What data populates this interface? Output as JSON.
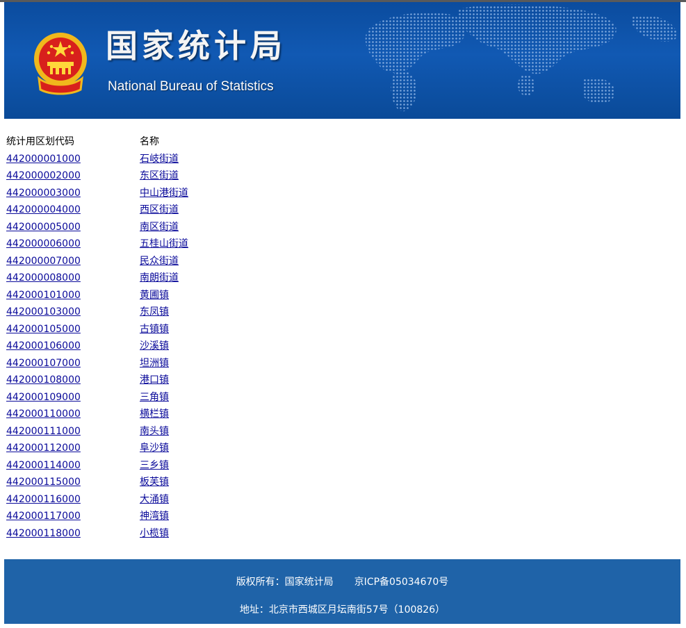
{
  "header": {
    "title_cn": "国家统计局",
    "title_en": "National Bureau of Statistics"
  },
  "table": {
    "col_code": "统计用区划代码",
    "col_name": "名称",
    "rows": [
      {
        "code": "442000001000",
        "name": "石岐街道"
      },
      {
        "code": "442000002000",
        "name": "东区街道"
      },
      {
        "code": "442000003000",
        "name": "中山港街道"
      },
      {
        "code": "442000004000",
        "name": "西区街道"
      },
      {
        "code": "442000005000",
        "name": "南区街道"
      },
      {
        "code": "442000006000",
        "name": "五桂山街道"
      },
      {
        "code": "442000007000",
        "name": "民众街道"
      },
      {
        "code": "442000008000",
        "name": "南朗街道"
      },
      {
        "code": "442000101000",
        "name": "黄圃镇"
      },
      {
        "code": "442000103000",
        "name": "东凤镇"
      },
      {
        "code": "442000105000",
        "name": "古镇镇"
      },
      {
        "code": "442000106000",
        "name": "沙溪镇"
      },
      {
        "code": "442000107000",
        "name": "坦洲镇"
      },
      {
        "code": "442000108000",
        "name": "港口镇"
      },
      {
        "code": "442000109000",
        "name": "三角镇"
      },
      {
        "code": "442000110000",
        "name": "横栏镇"
      },
      {
        "code": "442000111000",
        "name": "南头镇"
      },
      {
        "code": "442000112000",
        "name": "阜沙镇"
      },
      {
        "code": "442000114000",
        "name": "三乡镇"
      },
      {
        "code": "442000115000",
        "name": "板芙镇"
      },
      {
        "code": "442000116000",
        "name": "大涌镇"
      },
      {
        "code": "442000117000",
        "name": "神湾镇"
      },
      {
        "code": "442000118000",
        "name": "小榄镇"
      }
    ]
  },
  "footer": {
    "copyright": "版权所有：国家统计局",
    "icp": "京ICP备05034670号",
    "address": "地址：北京市西城区月坛南街57号（100826）"
  },
  "colors": {
    "banner": "#0b4c9e",
    "footer": "#1f63a8",
    "link": "#0a0a9a"
  },
  "icons": [
    "national-emblem-icon",
    "world-map-graphic"
  ]
}
